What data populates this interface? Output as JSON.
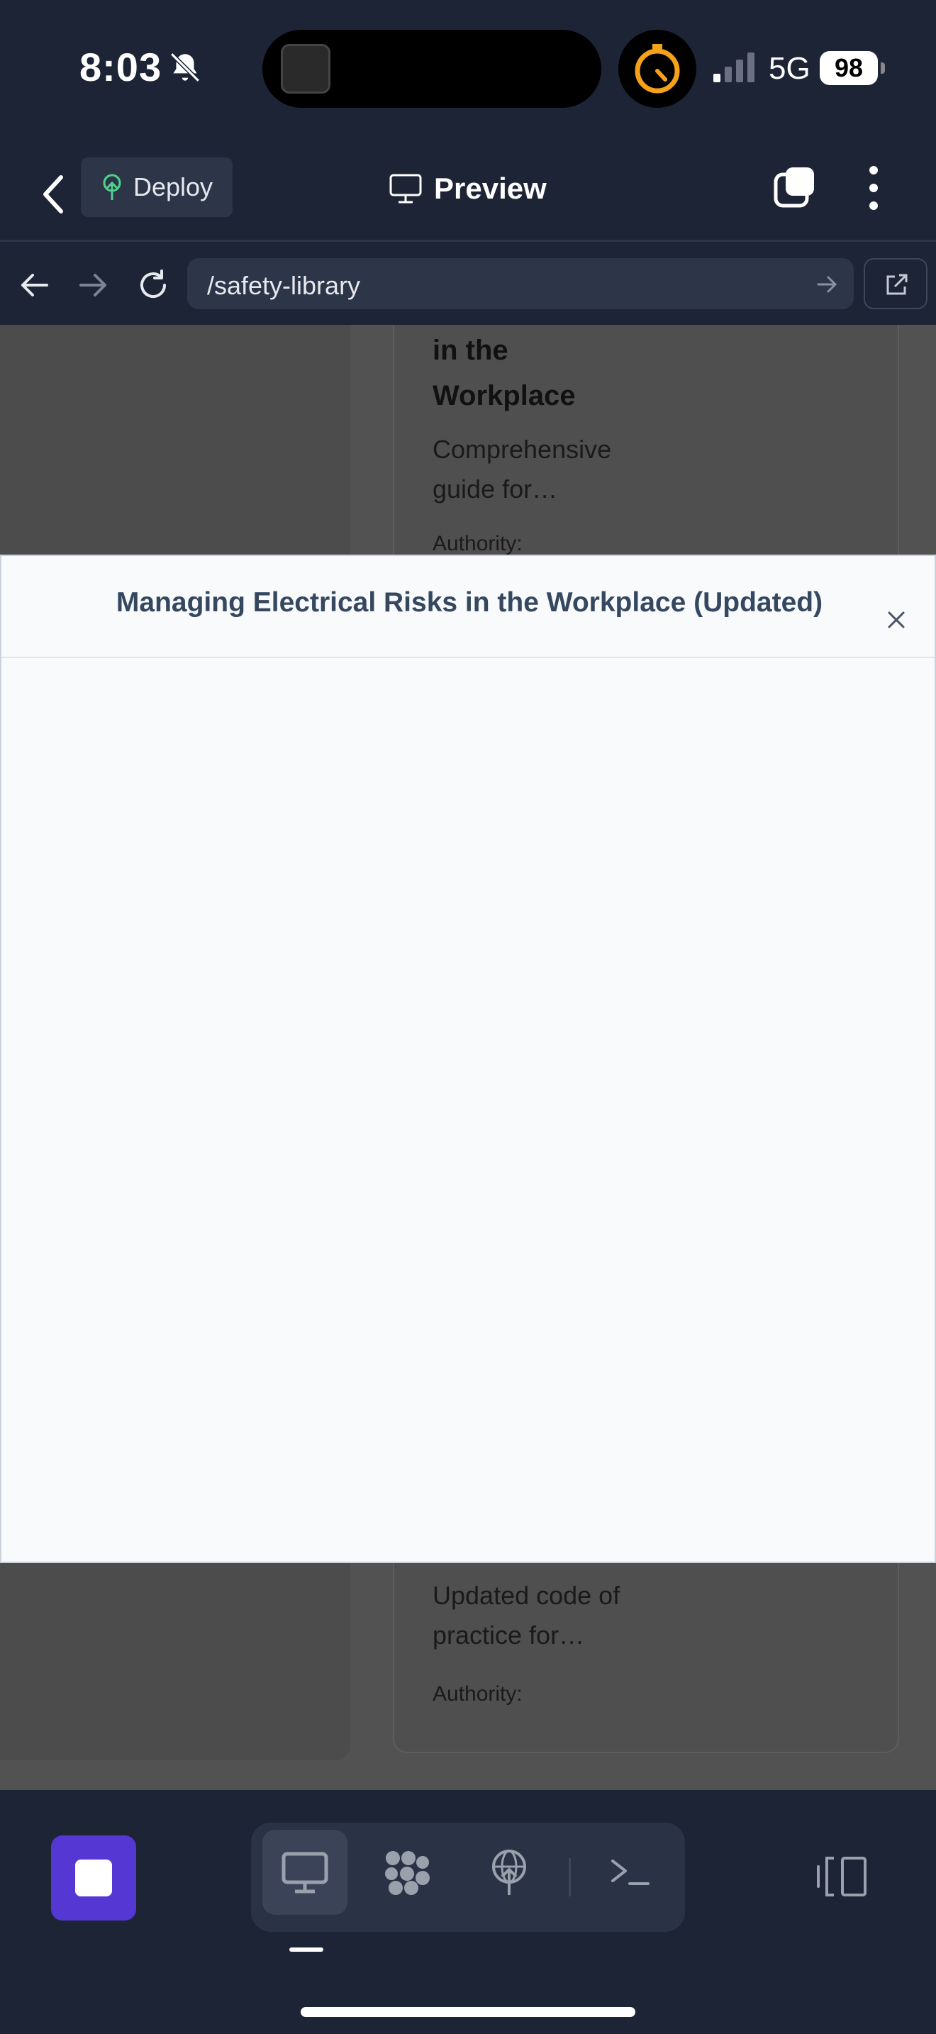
{
  "status_bar": {
    "time": "8:03",
    "network": "5G",
    "battery": "98"
  },
  "toolbar": {
    "deploy_label": "Deploy",
    "preview_label": "Preview"
  },
  "browser": {
    "url_path": "/safety-library"
  },
  "background_page": {
    "card_title": "in the Workplace",
    "card_description": "Comprehensive guide for…",
    "card_authority": "Authority:",
    "card2_description": "Updated code of practice for…",
    "card2_authority": "Authority:"
  },
  "modal": {
    "title": "Managing Electrical Risks in the Workplace (Updated)"
  },
  "colors": {
    "accent": "#5537d3",
    "background": "#1d2436",
    "modal_title": "#354860"
  }
}
